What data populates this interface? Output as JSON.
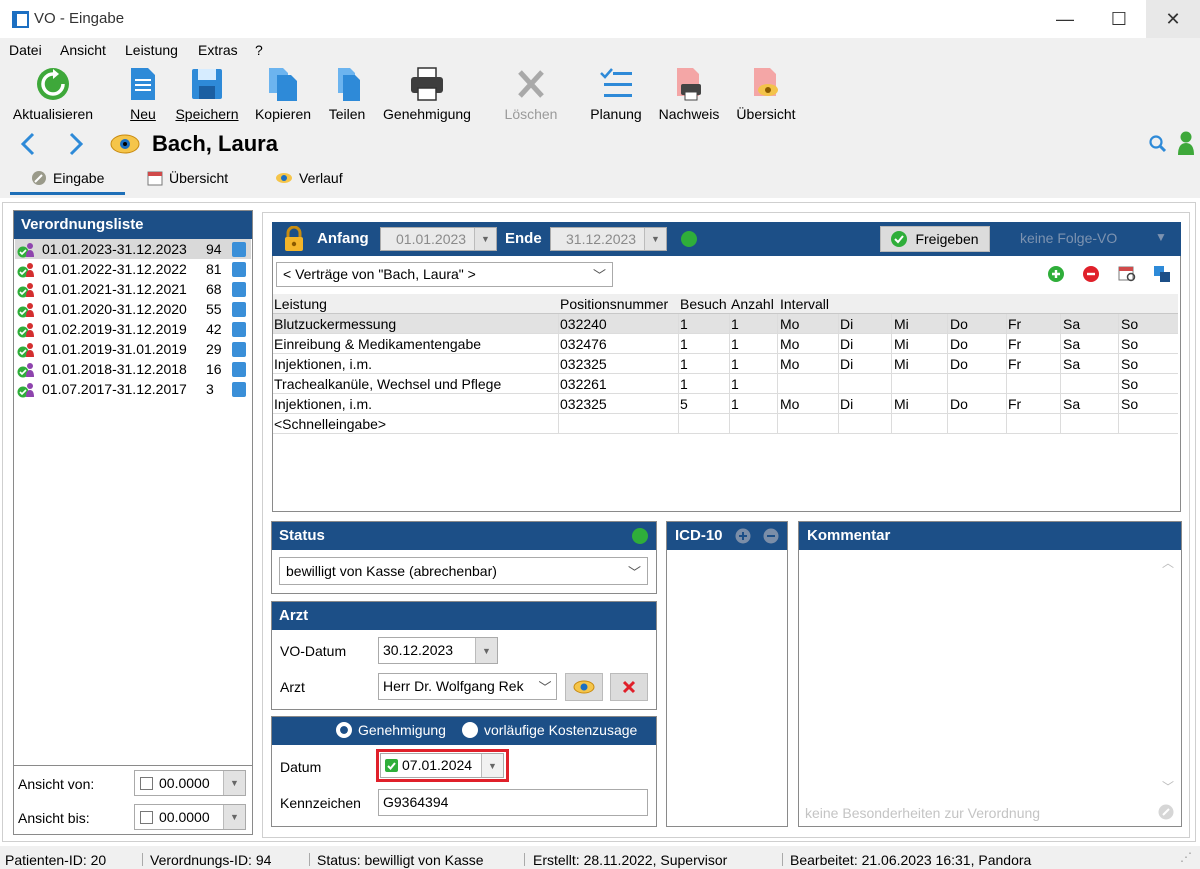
{
  "window": {
    "title": "VO - Eingabe",
    "controls": {
      "minimize": "—",
      "maximize": "☐",
      "close": "✕"
    }
  },
  "menu": [
    "Datei",
    "Ansicht",
    "Leistung",
    "Extras",
    "?"
  ],
  "toolbar": {
    "refresh": "Aktualisieren",
    "new": "Neu",
    "save": "Speichern",
    "copy": "Kopieren",
    "share": "Teilen",
    "approval": "Genehmigung",
    "delete": "Löschen",
    "planning": "Planung",
    "proof": "Nachweis",
    "overview": "Übersicht"
  },
  "patient": {
    "name": "Bach, Laura"
  },
  "tabs": [
    "Eingabe",
    "Übersicht",
    "Verlauf"
  ],
  "vo_list": {
    "title": "Verordnungsliste",
    "items": [
      {
        "range": "01.01.2023-31.12.2023",
        "count": "94",
        "icon_color": "#8e44ad"
      },
      {
        "range": "01.01.2022-31.12.2022",
        "count": "81",
        "icon_color": "#d32f2f"
      },
      {
        "range": "01.01.2021-31.12.2021",
        "count": "68",
        "icon_color": "#d32f2f"
      },
      {
        "range": "01.01.2020-31.12.2020",
        "count": "55",
        "icon_color": "#d32f2f"
      },
      {
        "range": "01.02.2019-31.12.2019",
        "count": "42",
        "icon_color": "#d32f2f"
      },
      {
        "range": "01.01.2019-31.01.2019",
        "count": "29",
        "icon_color": "#d32f2f"
      },
      {
        "range": "01.01.2018-31.12.2018",
        "count": "16",
        "icon_color": "#8e44ad"
      },
      {
        "range": "01.07.2017-31.12.2017",
        "count": "3",
        "icon_color": "#8e44ad"
      }
    ],
    "view_from_label": "Ansicht von:",
    "view_from_value": "00.0000",
    "view_to_label": "Ansicht bis:",
    "view_to_value": "00.0000"
  },
  "vo_header": {
    "start_label": "Anfang",
    "start_value": "01.01.2023",
    "end_label": "Ende",
    "end_value": "31.12.2023",
    "release_label": "Freigeben",
    "followup_label": "keine Folge-VO"
  },
  "contracts_select": "< Verträge von \"Bach, Laura\" >",
  "services": {
    "columns": [
      "Leistung",
      "Positionsnummer",
      "Besuch",
      "Anzahl",
      "Intervall"
    ],
    "rows": [
      {
        "service": "Blutzuckermessung",
        "pos": "032240",
        "visit": "1",
        "count": "1",
        "days": [
          "Mo",
          "Di",
          "Mi",
          "Do",
          "Fr",
          "Sa",
          "So"
        ]
      },
      {
        "service": "Einreibung & Medikamentengabe",
        "pos": "032476",
        "visit": "1",
        "count": "1",
        "days": [
          "Mo",
          "Di",
          "Mi",
          "Do",
          "Fr",
          "Sa",
          "So"
        ]
      },
      {
        "service": "Injektionen, i.m.",
        "pos": "032325",
        "visit": "1",
        "count": "1",
        "days": [
          "Mo",
          "Di",
          "Mi",
          "Do",
          "Fr",
          "Sa",
          "So"
        ]
      },
      {
        "service": "Trachealkanüle, Wechsel und Pflege",
        "pos": "032261",
        "visit": "1",
        "count": "1",
        "days": [
          "",
          "",
          "",
          "",
          "",
          "",
          "So"
        ]
      },
      {
        "service": "Injektionen, i.m.",
        "pos": "032325",
        "visit": "5",
        "count": "1",
        "days": [
          "Mo",
          "Di",
          "Mi",
          "Do",
          "Fr",
          "Sa",
          "So"
        ]
      }
    ],
    "quick_entry": "<Schnelleingabe>"
  },
  "status": {
    "title": "Status",
    "value": "bewilligt von Kasse (abrechenbar)"
  },
  "doctor": {
    "title": "Arzt",
    "vo_date_label": "VO-Datum",
    "vo_date_value": "30.12.2023",
    "doctor_label": "Arzt",
    "doctor_value": "Herr Dr. Wolfgang Rek"
  },
  "approval": {
    "radio_approval": "Genehmigung",
    "radio_provisional": "vorläufige Kostenzusage",
    "date_label": "Datum",
    "date_value": "07.01.2024",
    "code_label": "Kennzeichen",
    "code_value": "G9364394"
  },
  "icd": {
    "title": "ICD-10"
  },
  "comment": {
    "title": "Kommentar",
    "placeholder": "keine Besonderheiten zur Verordnung"
  },
  "statusbar": {
    "patient_id": "Patienten-ID: 20",
    "vo_id": "Verordnungs-ID: 94",
    "status": "Status: bewilligt von Kasse",
    "created": "Erstellt: 28.11.2022, Supervisor",
    "edited": "Bearbeitet: 21.06.2023 16:31, Pandora"
  },
  "colors": {
    "header_blue": "#1c4f87",
    "accent_green": "#2fae3a",
    "highlight_red": "#e0202a"
  }
}
